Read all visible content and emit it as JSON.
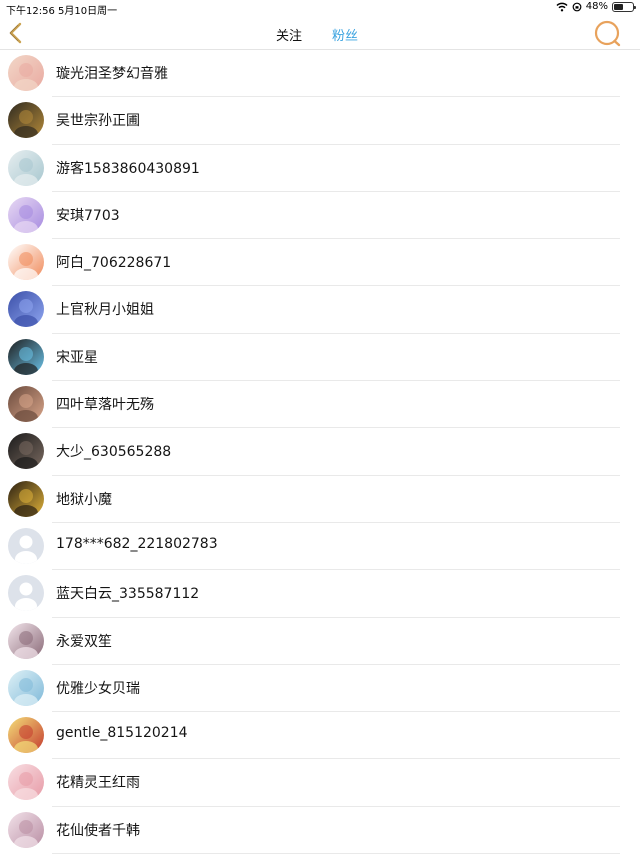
{
  "status_bar": {
    "time_date": "下午12:56   5月10日周一",
    "battery": "48%",
    "battery_level": 0.48
  },
  "nav": {
    "back_icon": "chevron-left-icon",
    "tabs": [
      {
        "label": "关注",
        "active": false
      },
      {
        "label": "粉丝",
        "active": true
      }
    ],
    "search_icon": "search-icon",
    "accent": "#3aa3e0",
    "icon_color": "#e8a25c"
  },
  "followers": [
    {
      "name": "璇光泪圣梦幻音雅",
      "avatar": "anime-girl-avatar",
      "c1": "#f2d7c8",
      "c2": "#e9a9a0"
    },
    {
      "name": "吴世宗孙正圃",
      "avatar": "photo-avatar",
      "c1": "#2f2a20",
      "c2": "#b48a3a"
    },
    {
      "name": "游客1583860430891",
      "avatar": "anime-girl-avatar",
      "c1": "#e7eef0",
      "c2": "#a7c7cf"
    },
    {
      "name": "安琪7703",
      "avatar": "anime-girl-avatar",
      "c1": "#e8d9f3",
      "c2": "#a68be0"
    },
    {
      "name": "阿白_706228671",
      "avatar": "cartoon-avatar",
      "c1": "#ffffff",
      "c2": "#f08a5a"
    },
    {
      "name": "上官秋月小姐姐",
      "avatar": "anime-avatar",
      "c1": "#3b4fa8",
      "c2": "#8fa6f0"
    },
    {
      "name": "宋亚星",
      "avatar": "photo-avatar",
      "c1": "#1e1e1e",
      "c2": "#6cc4ea"
    },
    {
      "name": "四叶草落叶无殇",
      "avatar": "photo-avatar",
      "c1": "#6a4a3c",
      "c2": "#d9a58a"
    },
    {
      "name": "大少_630565288",
      "avatar": "photo-avatar",
      "c1": "#1a1a1a",
      "c2": "#7a6a60"
    },
    {
      "name": "地狱小魔",
      "avatar": "text-avatar",
      "c1": "#2a2012",
      "c2": "#e0b23a"
    },
    {
      "name": "178***682_221802783",
      "avatar": "default-avatar",
      "c1": "#dde2ea",
      "c2": "#ffffff"
    },
    {
      "name": "蓝天白云_335587112",
      "avatar": "default-avatar",
      "c1": "#dde2ea",
      "c2": "#ffffff"
    },
    {
      "name": "永爱双笙",
      "avatar": "anime-girl-avatar",
      "c1": "#f3e6ec",
      "c2": "#8a6a78"
    },
    {
      "name": "优雅少女贝瑞",
      "avatar": "anime-girl-avatar",
      "c1": "#dff1f6",
      "c2": "#7fb9d9"
    },
    {
      "name": "gentle_815120214",
      "avatar": "cartoon-avatar",
      "c1": "#f4e07a",
      "c2": "#c43a2e"
    },
    {
      "name": "花精灵王红雨",
      "avatar": "anime-girl-avatar",
      "c1": "#f8dfe3",
      "c2": "#e79aa6"
    },
    {
      "name": "花仙使者千韩",
      "avatar": "anime-girl-avatar",
      "c1": "#f2e2ea",
      "c2": "#b98ea3"
    }
  ]
}
